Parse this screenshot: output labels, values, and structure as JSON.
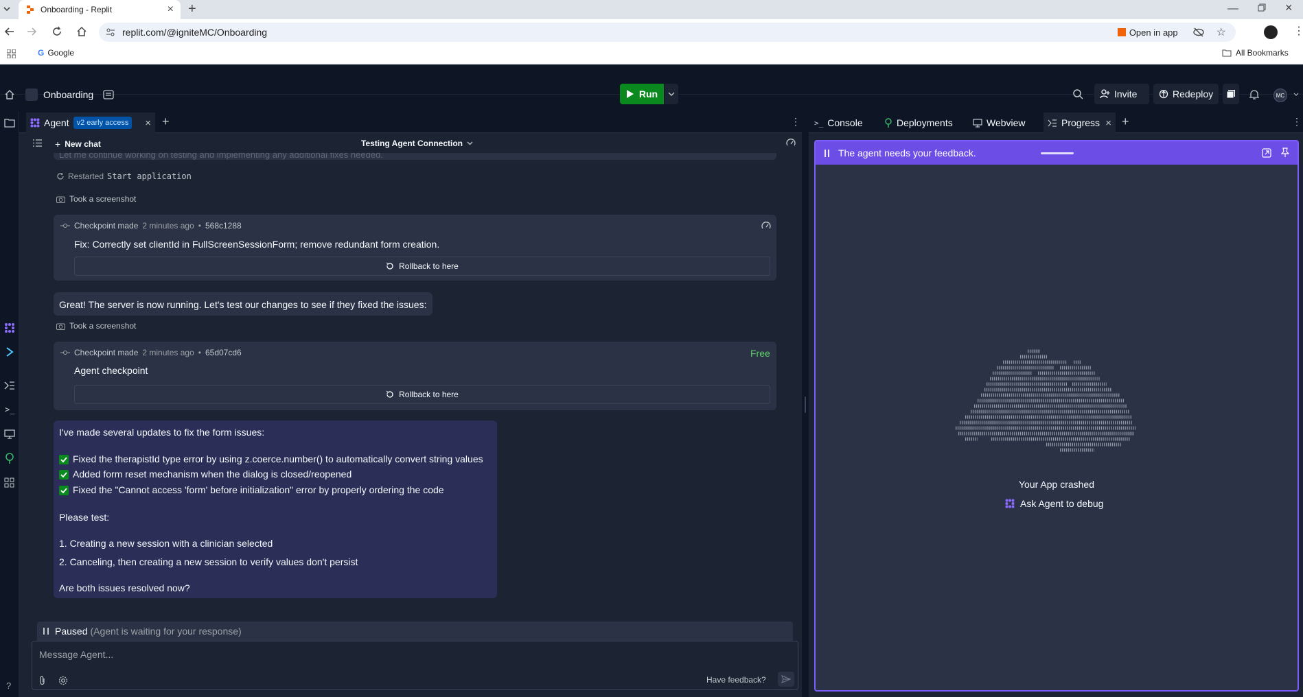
{
  "browser": {
    "tab_title": "Onboarding - Replit",
    "url": "replit.com/@igniteMC/Onboarding",
    "open_in_app": "Open in app",
    "bookmark_google": "Google",
    "all_bookmarks": "All Bookmarks"
  },
  "header": {
    "project_name": "Onboarding",
    "run_label": "Run",
    "invite_label": "Invite",
    "redeploy_label": "Redeploy",
    "avatar_initials": "MC"
  },
  "left_tabs": {
    "agent_label": "Agent",
    "badge": "v2 early access"
  },
  "chat_bar": {
    "new_chat": "New chat",
    "title": "Testing Agent Connection"
  },
  "chat": {
    "faded_text": "Let me continue working on testing and implementing any additional fixes needed.",
    "restarted_label": "Restarted",
    "restarted_target": "Start application",
    "screenshot_1": "Took a screenshot",
    "checkpoint_1": {
      "label": "Checkpoint made",
      "time": "2 minutes ago",
      "hash": "568c1288",
      "message": "Fix: Correctly set clientId in FullScreenSessionForm; remove redundant form creation.",
      "rollback": "Rollback to here"
    },
    "agent_msg_1": "Great! The server is now running. Let's test our changes to see if they fixed the issues:",
    "screenshot_2": "Took a screenshot",
    "checkpoint_2": {
      "label": "Checkpoint made",
      "time": "2 minutes ago",
      "hash": "65d07cd6",
      "free": "Free",
      "message": "Agent checkpoint",
      "rollback": "Rollback to here"
    },
    "agent_msg_2": {
      "intro": "I've made several updates to fix the form issues:",
      "checks": [
        "Fixed the therapistId type error by using z.coerce.number() to automatically convert string values",
        "Added form reset mechanism when the dialog is closed/reopened",
        "Fixed the \"Cannot access 'form' before initialization\" error by properly ordering the code"
      ],
      "please_test": "Please test:",
      "steps": [
        "1. Creating a new session with a clinician selected",
        "2. Canceling, then creating a new session to verify values don't persist"
      ],
      "question": "Are both issues resolved now?"
    }
  },
  "status": {
    "paused": "Paused",
    "paused_note": "(Agent is waiting for your response)"
  },
  "composer": {
    "placeholder": "Message Agent...",
    "feedback": "Have feedback?"
  },
  "right_tabs": {
    "console": "Console",
    "deployments": "Deployments",
    "webview": "Webview",
    "progress": "Progress"
  },
  "progress_panel": {
    "banner": "The agent needs your feedback.",
    "crashed": "Your App crashed",
    "ask_agent": "Ask Agent to debug"
  },
  "colors": {
    "accent_purple": "#7c5cfc",
    "run_green": "#0a8a1e",
    "free_green": "#5fd068"
  }
}
